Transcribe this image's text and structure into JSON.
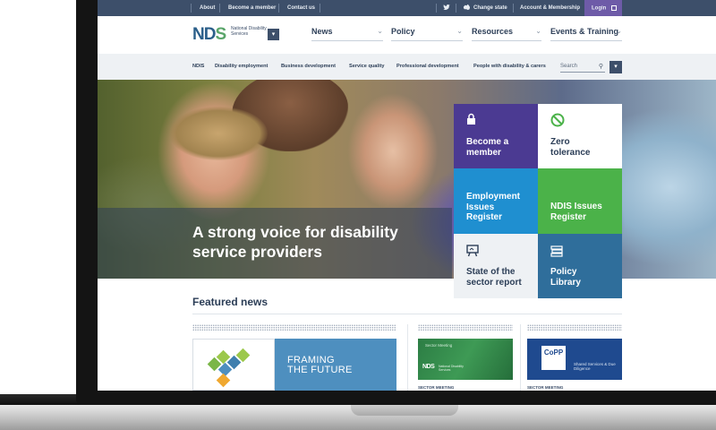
{
  "utility_bar": {
    "links": [
      "About",
      "Become a member",
      "Contact us"
    ],
    "change_state": "Change state",
    "account": "Account & Membership",
    "login": "Login"
  },
  "logo": {
    "mark_n": "N",
    "mark_d": "D",
    "mark_s": "S",
    "text": "National Disability Services"
  },
  "main_nav": [
    {
      "label": "News"
    },
    {
      "label": "Policy"
    },
    {
      "label": "Resources"
    },
    {
      "label": "Events & Training"
    }
  ],
  "sub_nav": [
    "NDIS",
    "Disability employment",
    "Business development",
    "Service quality",
    "Professional development",
    "People with disability & carers"
  ],
  "search": {
    "placeholder": "Search"
  },
  "hero": {
    "heading": "A strong voice for disability service providers"
  },
  "tiles": [
    {
      "label": "Become a member",
      "icon": "lock-icon",
      "color": "#4b3a92"
    },
    {
      "label": "Zero tolerance",
      "icon": "no-entry-icon",
      "color": "#ffffff"
    },
    {
      "label": "Employment Issues Register",
      "icon": "",
      "color": "#1f8fd0"
    },
    {
      "label": "NDIS Issues Register",
      "icon": "",
      "color": "#4bb249"
    },
    {
      "label": "State of the sector report",
      "icon": "presentation-icon",
      "color": "#eef1f4"
    },
    {
      "label": "Policy Library",
      "icon": "books-icon",
      "color": "#2f6e9b"
    }
  ],
  "featured": {
    "title": "Featured news",
    "cards": [
      {
        "headline_line1": "FRAMING",
        "headline_line2": "THE FUTURE",
        "category": ""
      },
      {
        "small_text": "Sector Meeting",
        "logo": "NDS",
        "logo_sub": "National Disability Services",
        "category": "SECTOR MEETING"
      },
      {
        "logo": "CoPP",
        "sub": "Shared Services & Due Diligence",
        "category": "SECTOR MEETING"
      }
    ]
  },
  "colors": {
    "utility_bar": "#3d4f6a",
    "login": "#6e5ba8",
    "brand_blue": "#2b5f8a",
    "brand_green": "#5aa56a"
  }
}
